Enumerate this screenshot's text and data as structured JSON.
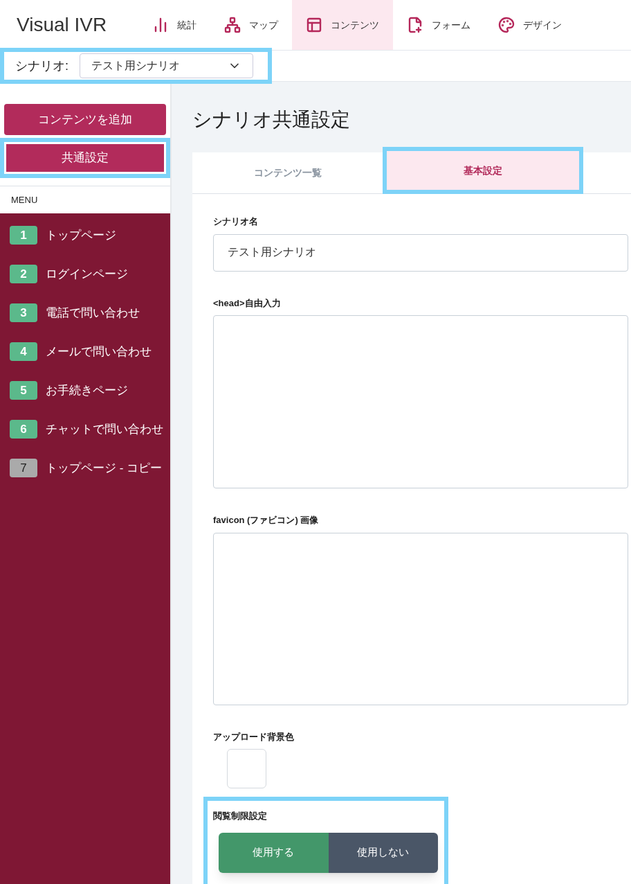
{
  "app": {
    "logo": "Visual IVR"
  },
  "nav": [
    {
      "label": "統計",
      "kind": "stats",
      "selected": false
    },
    {
      "label": "マップ",
      "kind": "map",
      "selected": false
    },
    {
      "label": "コンテンツ",
      "kind": "contents",
      "selected": true
    },
    {
      "label": "フォーム",
      "kind": "form",
      "selected": false
    },
    {
      "label": "デザイン",
      "kind": "design",
      "selected": false
    }
  ],
  "scenario_bar": {
    "label": "シナリオ:",
    "value": "テスト用シナリオ"
  },
  "sidebar": {
    "add_button": "コンテンツを追加",
    "common_button": "共通設定",
    "menu_label": "MENU",
    "items": [
      {
        "number": "1",
        "label": "トップページ",
        "color": "#5bb98b"
      },
      {
        "number": "2",
        "label": "ログインページ",
        "color": "#5bb98b"
      },
      {
        "number": "3",
        "label": "電話で問い合わせ",
        "color": "#5bb98b"
      },
      {
        "number": "4",
        "label": "メールで問い合わせ",
        "color": "#5bb98b"
      },
      {
        "number": "5",
        "label": "お手続きページ",
        "color": "#5bb98b"
      },
      {
        "number": "6",
        "label": "チャットで問い合わせ",
        "color": "#5bb98b"
      },
      {
        "number": "7",
        "label": "トップページ - コピー",
        "color": "#aaaaaa"
      }
    ]
  },
  "main": {
    "title": "シナリオ共通設定",
    "tabs": [
      {
        "label": "コンテンツ一覧",
        "selected": false
      },
      {
        "label": "基本設定",
        "selected": true
      }
    ],
    "fields": [
      {
        "kind": "input",
        "label": "シナリオ名",
        "value": "テスト用シナリオ"
      },
      {
        "kind": "textarea",
        "label": "<head>自由入力"
      },
      {
        "kind": "image",
        "label": "favicon (ファビコン) 画像"
      },
      {
        "kind": "color",
        "label": "アップロード背景色"
      }
    ],
    "access": {
      "label": "閲覧制限設定",
      "options": [
        {
          "label": "使用する",
          "selected": true
        },
        {
          "label": "使用しない",
          "selected": false
        }
      ]
    }
  }
}
